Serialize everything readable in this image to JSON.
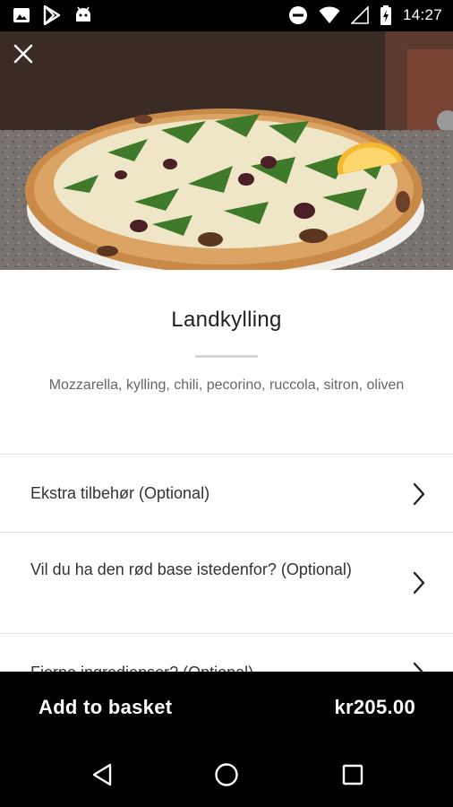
{
  "status_bar": {
    "time": "14:27",
    "left_icons": [
      "image-icon",
      "play-store-icon",
      "android-icon"
    ],
    "right_icons": [
      "do-not-disturb-icon",
      "wifi-icon",
      "signal-icon",
      "battery-charging-icon"
    ]
  },
  "hero": {
    "image": "pizza-photo",
    "close_icon": "close-icon"
  },
  "product": {
    "name": "Landkylling",
    "description": "Mozzarella, kylling, chili, pecorino, ruccola, sitron, oliven"
  },
  "options": [
    {
      "label": "Ekstra tilbehør (Optional)",
      "icon": "chevron-right-icon"
    },
    {
      "label": "Vil du ha den rød base istedenfor? (Optional)",
      "icon": "chevron-right-icon"
    },
    {
      "label": "Fjerne ingredienser? (Optional)",
      "icon": "chevron-right-icon"
    }
  ],
  "basket": {
    "label": "Add to basket",
    "price": "kr205.00"
  },
  "nav_bar": {
    "buttons": [
      "back-triangle-icon",
      "home-circle-icon",
      "recents-square-icon"
    ]
  },
  "colors": {
    "bars": "#000000",
    "background": "#ffffff",
    "title": "#222222",
    "description": "#666666",
    "divider": "#e3e3e3"
  }
}
